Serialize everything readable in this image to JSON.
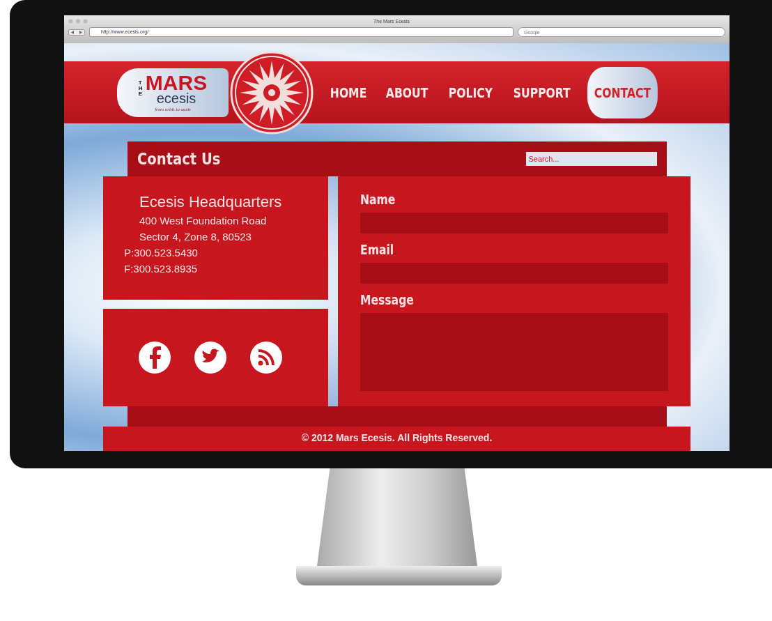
{
  "browser": {
    "title": "The Mars Ecesis",
    "url": "http://www.ecesis.org/",
    "search_placeholder": "Google"
  },
  "logo": {
    "prefix": "THE",
    "name": "MARS",
    "sub": "ecesis",
    "tagline": "from orbit to oasis"
  },
  "nav": [
    {
      "label": "HOME",
      "selected": false
    },
    {
      "label": "ABOUT",
      "selected": false
    },
    {
      "label": "POLICY",
      "selected": false
    },
    {
      "label": "SUPPORT",
      "selected": false
    },
    {
      "label": "CONTACT",
      "selected": true
    }
  ],
  "contact": {
    "heading": "Contact Us",
    "search_placeholder": "Search...",
    "address": {
      "title": "Ecesis Headquarters",
      "lines": [
        "400 West Foundation Road",
        "Sector 4, Zone 8, 80523"
      ],
      "phone": "P:300.523.5430",
      "fax": "F:300.523.8935"
    },
    "social": [
      {
        "kind": "facebook"
      },
      {
        "kind": "twitter"
      },
      {
        "kind": "rss"
      }
    ],
    "fields": [
      {
        "label": "Name",
        "kind": "line"
      },
      {
        "label": "Email",
        "kind": "line"
      },
      {
        "label": "Message",
        "kind": "area"
      }
    ]
  },
  "footer": "© 2012 Mars Ecesis. All Rights Reserved."
}
